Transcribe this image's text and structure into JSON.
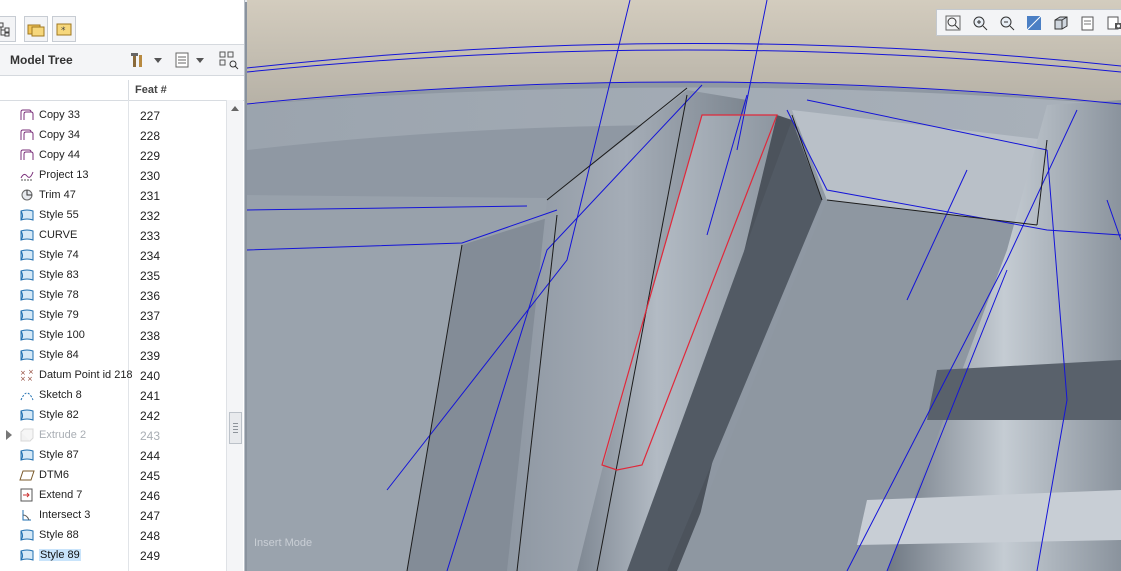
{
  "model_tree": {
    "title": "Model Tree",
    "column_header": "Feat #",
    "rows": [
      {
        "name": "Copy 33",
        "num": "227",
        "icon": "copy-icon"
      },
      {
        "name": "Copy 34",
        "num": "228",
        "icon": "copy-icon"
      },
      {
        "name": "Copy 44",
        "num": "229",
        "icon": "copy-icon"
      },
      {
        "name": "Project 13",
        "num": "230",
        "icon": "project-icon"
      },
      {
        "name": "Trim 47",
        "num": "231",
        "icon": "trim-icon"
      },
      {
        "name": "Style 55",
        "num": "232",
        "icon": "style-icon"
      },
      {
        "name": "CURVE",
        "num": "233",
        "icon": "style-icon"
      },
      {
        "name": "Style 74",
        "num": "234",
        "icon": "style-icon"
      },
      {
        "name": "Style 83",
        "num": "235",
        "icon": "style-icon"
      },
      {
        "name": "Style 78",
        "num": "236",
        "icon": "style-icon"
      },
      {
        "name": "Style 79",
        "num": "237",
        "icon": "style-icon"
      },
      {
        "name": "Style 100",
        "num": "238",
        "icon": "style-icon"
      },
      {
        "name": "Style 84",
        "num": "239",
        "icon": "style-icon"
      },
      {
        "name": "Datum Point id 218",
        "num": "240",
        "icon": "datum-point-icon"
      },
      {
        "name": "Sketch 8",
        "num": "241",
        "icon": "sketch-icon"
      },
      {
        "name": "Style 82",
        "num": "242",
        "icon": "style-icon"
      },
      {
        "name": "Extrude 2",
        "num": "243",
        "icon": "extrude-icon",
        "dim": true,
        "expandable": true
      },
      {
        "name": "Style 87",
        "num": "244",
        "icon": "style-icon"
      },
      {
        "name": "DTM6",
        "num": "245",
        "icon": "datum-plane-icon"
      },
      {
        "name": "Extend 7",
        "num": "246",
        "icon": "extend-icon"
      },
      {
        "name": "Intersect 3",
        "num": "247",
        "icon": "intersect-icon"
      },
      {
        "name": "Style 88",
        "num": "248",
        "icon": "style-icon"
      },
      {
        "name": "Style 89",
        "num": "249",
        "icon": "style-icon",
        "selected": true
      }
    ]
  },
  "viewport": {
    "mode_label": "Insert Mode",
    "toolbar": [
      "refit-icon",
      "zoom-in-icon",
      "zoom-out-icon",
      "repaint-icon",
      "display-style-icon",
      "saved-views-icon",
      "view-manager-icon",
      "datum-display-icon",
      "spin-center-icon",
      "annotation-display-icon"
    ]
  },
  "colors": {
    "selection": "#c9e4fb",
    "curve_blue": "#1e1ee6",
    "highlight_red": "#e0283a"
  }
}
